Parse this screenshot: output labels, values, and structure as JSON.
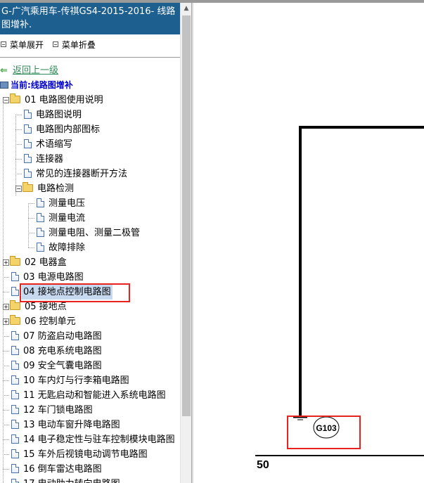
{
  "sidebar": {
    "title": "G-广汽乘用车-传祺GS4-2015-2016- 线路图增补.",
    "expand_all": "菜单展开",
    "collapse_all": "菜单折叠",
    "back_link": "返回上一级",
    "current_section": "当前:线路图增补",
    "tree": [
      {
        "label": "01 电路图使用说明",
        "type": "folder",
        "level": 0,
        "expanded": true
      },
      {
        "label": "电路图说明",
        "type": "doc",
        "level": 1
      },
      {
        "label": "电路图内部图标",
        "type": "doc",
        "level": 1
      },
      {
        "label": "术语缩写",
        "type": "doc",
        "level": 1
      },
      {
        "label": "连接器",
        "type": "doc",
        "level": 1
      },
      {
        "label": "常见的连接器断开方法",
        "type": "doc",
        "level": 1
      },
      {
        "label": "电路检测",
        "type": "folder",
        "level": 1,
        "expanded": true
      },
      {
        "label": "测量电压",
        "type": "doc",
        "level": 2
      },
      {
        "label": "测量电流",
        "type": "doc",
        "level": 2
      },
      {
        "label": "测量电阻、测量二极管",
        "type": "doc",
        "level": 2
      },
      {
        "label": "故障排除",
        "type": "doc",
        "level": 2
      },
      {
        "label": "02 电器盒",
        "type": "folder",
        "level": 0,
        "expanded": false
      },
      {
        "label": "03 电源电路图",
        "type": "doc",
        "level": 0
      },
      {
        "label": "04 接地点控制电路图",
        "type": "doc",
        "level": 0,
        "selected": true
      },
      {
        "label": "05 接地点",
        "type": "folder",
        "level": 0,
        "expanded": false
      },
      {
        "label": "06 控制单元",
        "type": "folder",
        "level": 0,
        "expanded": false
      },
      {
        "label": "07 防盗启动电路图",
        "type": "doc",
        "level": 0
      },
      {
        "label": "08 充电系统电路图",
        "type": "doc",
        "level": 0
      },
      {
        "label": "09 安全气囊电路图",
        "type": "doc",
        "level": 0
      },
      {
        "label": "10 车内灯与行李箱电路图",
        "type": "doc",
        "level": 0
      },
      {
        "label": "11 无匙启动和智能进入系统电路图",
        "type": "doc",
        "level": 0
      },
      {
        "label": "12 车门锁电路图",
        "type": "doc",
        "level": 0
      },
      {
        "label": "13 电动车窗升降电路图",
        "type": "doc",
        "level": 0
      },
      {
        "label": "14 电子稳定性与驻车控制模块电路图",
        "type": "doc",
        "level": 0
      },
      {
        "label": "15 车外后视镜电动调节电路图",
        "type": "doc",
        "level": 0
      },
      {
        "label": "16 倒车雷达电路图",
        "type": "doc",
        "level": 0
      },
      {
        "label": "17 电动助力转向电路图",
        "type": "doc",
        "level": 0
      }
    ]
  },
  "scrollbar": {
    "up_arrow": "▲"
  },
  "diagram": {
    "ground_label": "G103",
    "page_number": "50"
  },
  "colors": {
    "title_bar": "#1d5f8f",
    "highlight": "#e8221f",
    "selected": "#c7d9ef",
    "link": "#2e8b57",
    "current": "#0000cc"
  },
  "icons": {
    "back": "green-left-arrow-icon",
    "current": "monitor-icon",
    "folder": "folder-icon",
    "document": "document-icon"
  }
}
